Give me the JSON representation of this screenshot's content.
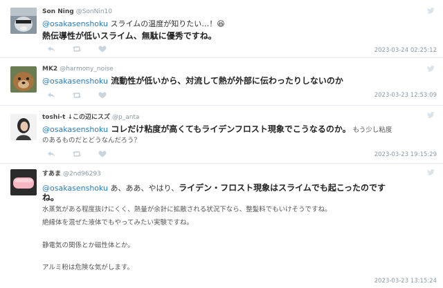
{
  "tweets": [
    {
      "name": "Son Ning",
      "handle": "@SonNin10",
      "mention": "@osakasenshoku",
      "text_a": " スライムの温度が知りたい…！😆",
      "text_b": "熱伝導性が低いスライム、無駄に優秀ですね。",
      "timestamp": "2023-03-24 02:25:12"
    },
    {
      "name": "MK2",
      "handle": "@harmony_noise",
      "mention": "@osakasenshoku",
      "text_a": " 流動性が低いから、対流して熱が外部に伝わったりしないのか",
      "timestamp": "2023-03-23 12:53:09"
    },
    {
      "name": "toshi-t ↓この辺にスズ",
      "handle": "@p_anta",
      "mention": "@osakasenshoku",
      "text_a": " コレだけ粘度が高くてもライデンフロスト現象でこうなるのか。",
      "text_b": " もう少し粘度",
      "text_c": "のあるものだとどうなんだろう？",
      "timestamp": "2023-03-23 19:15:29"
    },
    {
      "name": "すあま",
      "handle": "@2nd96293",
      "mention": "@osakasenshoku",
      "text_a": " あ、ああ、やはり、",
      "text_b": "ライデン・フロスト現象はスライムでも起こったのです",
      "text_c": "ね。",
      "line1": "水蒸気がある程度抜けにくく、熱量が余計に拡散される状況下なら、整髪料でもいけそうですね。",
      "line2": "絶縁体を混ぜた液体でもやってみたい実験ですね。",
      "line3": "静電気の関係とか磁性体とか。",
      "line4": "アルミ粉は危険な気がします。",
      "timestamp": "2023-03-23 13:15:24"
    }
  ],
  "icons": {
    "reply": "reply-icon",
    "retweet": "retweet-icon",
    "like": "heart-icon",
    "brand": "bird-icon"
  },
  "colors": {
    "mention": "#2b7bb9",
    "muted": "#8899a6",
    "divider": "#e6ecf0"
  }
}
